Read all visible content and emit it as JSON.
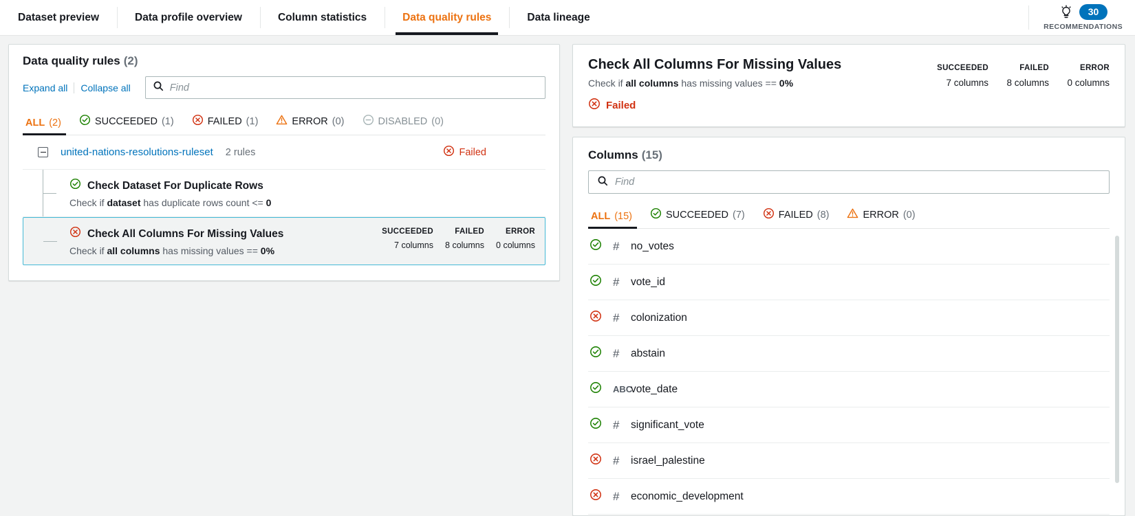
{
  "header": {
    "tabs": [
      {
        "label": "Dataset preview",
        "active": false
      },
      {
        "label": "Data profile overview",
        "active": false
      },
      {
        "label": "Column statistics",
        "active": false
      },
      {
        "label": "Data quality rules",
        "active": true
      },
      {
        "label": "Data lineage",
        "active": false
      }
    ],
    "recommendations": {
      "count": "30",
      "label": "RECOMMENDATIONS",
      "icon": "lightbulb-icon",
      "badge_color": "#0073bb"
    }
  },
  "rules_panel": {
    "title": "Data quality rules",
    "count": "(2)",
    "expand_all": "Expand all",
    "collapse_all": "Collapse all",
    "search_placeholder": "Find",
    "search_value": "",
    "filters": [
      {
        "label": "ALL",
        "count": "(2)",
        "icon": "none",
        "active": true,
        "disabled": false
      },
      {
        "label": "SUCCEEDED",
        "count": "(1)",
        "icon": "check-circle-icon",
        "active": false,
        "disabled": false
      },
      {
        "label": "FAILED",
        "count": "(1)",
        "icon": "error-circle-icon",
        "active": false,
        "disabled": false
      },
      {
        "label": "ERROR",
        "count": "(0)",
        "icon": "warning-triangle-icon",
        "active": false,
        "disabled": false
      },
      {
        "label": "DISABLED",
        "count": "(0)",
        "icon": "minus-circle-icon",
        "active": false,
        "disabled": true
      }
    ],
    "ruleset": {
      "name": "united-nations-resolutions-ruleset",
      "rules_count": "2 rules",
      "status": "Failed"
    },
    "rules": [
      {
        "name": "Check Dataset For Duplicate Rows",
        "desc_pre": "Check if ",
        "desc_bold1": "dataset",
        "desc_mid": " has duplicate rows count <= ",
        "desc_bold2": "0",
        "status_icon": "check-circle-icon",
        "selected": false,
        "show_stats": false
      },
      {
        "name": "Check All Columns For Missing Values",
        "desc_pre": "Check if ",
        "desc_bold1": "all columns",
        "desc_mid": " has missing values == ",
        "desc_bold2": "0%",
        "status_icon": "error-circle-icon",
        "selected": true,
        "show_stats": true,
        "stats": [
          {
            "label": "SUCCEEDED",
            "value": "7 columns"
          },
          {
            "label": "FAILED",
            "value": "8 columns"
          },
          {
            "label": "ERROR",
            "value": "0 columns"
          }
        ]
      }
    ]
  },
  "detail_panel": {
    "title": "Check All Columns For Missing Values",
    "desc_pre": "Check if ",
    "desc_bold1": "all columns",
    "desc_mid": " has missing values == ",
    "desc_bold2": "0%",
    "status": "Failed",
    "status_icon": "error-circle-icon",
    "stats": [
      {
        "label": "SUCCEEDED",
        "value": "7 columns"
      },
      {
        "label": "FAILED",
        "value": "8 columns"
      },
      {
        "label": "ERROR",
        "value": "0 columns"
      }
    ]
  },
  "columns_panel": {
    "title": "Columns",
    "count": "(15)",
    "search_placeholder": "Find",
    "search_value": "",
    "filters": [
      {
        "label": "ALL",
        "count": "(15)",
        "icon": "none",
        "active": true
      },
      {
        "label": "SUCCEEDED",
        "count": "(7)",
        "icon": "check-circle-icon",
        "active": false
      },
      {
        "label": "FAILED",
        "count": "(8)",
        "icon": "error-circle-icon",
        "active": false
      },
      {
        "label": "ERROR",
        "count": "(0)",
        "icon": "warning-triangle-icon",
        "active": false
      }
    ],
    "rows": [
      {
        "status": "success",
        "type": "#",
        "type_kind": "num",
        "name": "no_votes"
      },
      {
        "status": "success",
        "type": "#",
        "type_kind": "num",
        "name": "vote_id"
      },
      {
        "status": "failed",
        "type": "#",
        "type_kind": "num",
        "name": "colonization"
      },
      {
        "status": "success",
        "type": "#",
        "type_kind": "num",
        "name": "abstain"
      },
      {
        "status": "success",
        "type": "ABC",
        "type_kind": "str",
        "name": "vote_date"
      },
      {
        "status": "success",
        "type": "#",
        "type_kind": "num",
        "name": "significant_vote"
      },
      {
        "status": "failed",
        "type": "#",
        "type_kind": "num",
        "name": "israel_palestine"
      },
      {
        "status": "failed",
        "type": "#",
        "type_kind": "num",
        "name": "economic_development"
      }
    ]
  },
  "colors": {
    "accent_orange": "#ec7211",
    "link_blue": "#0073bb",
    "success_green": "#1d8102",
    "error_red": "#d13212",
    "warning_orange": "#ec7211",
    "selected_border": "#44b9d6"
  }
}
